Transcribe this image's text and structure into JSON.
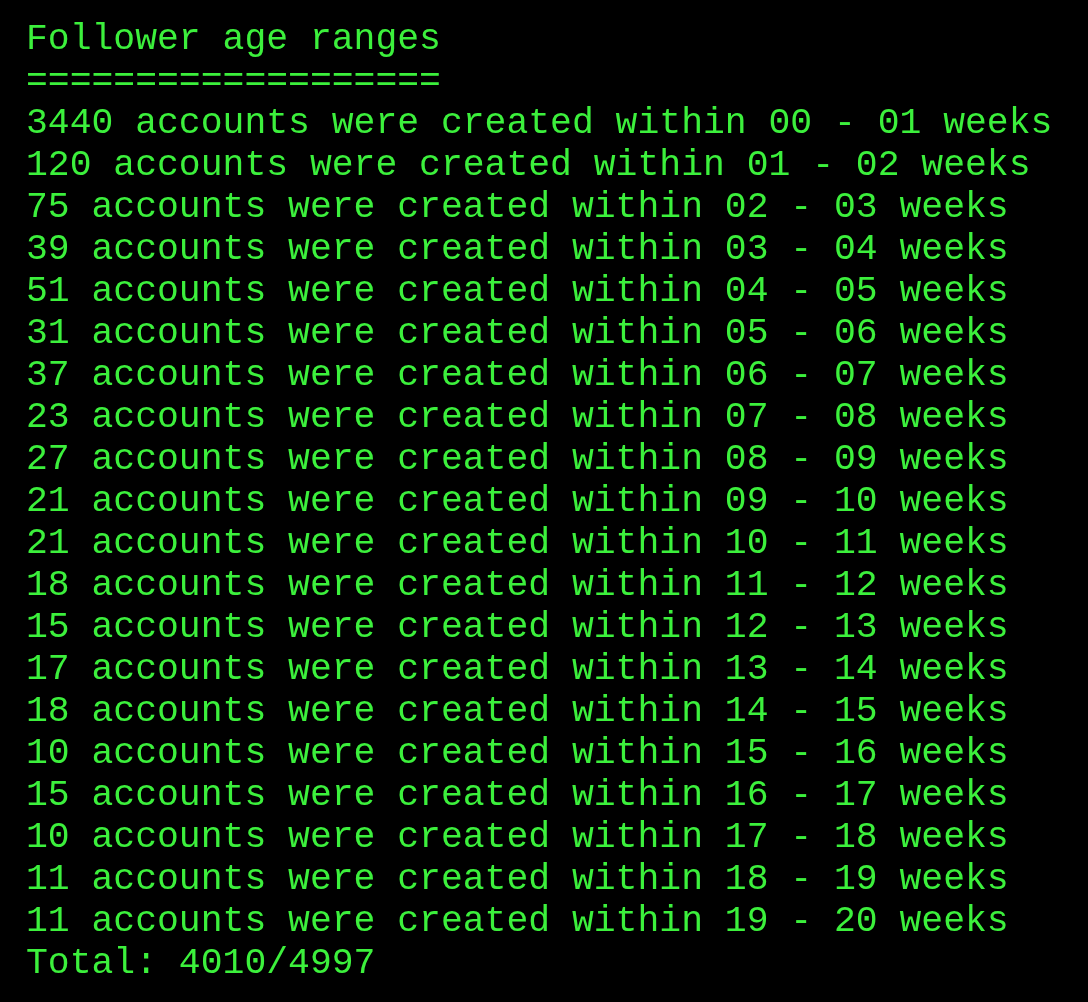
{
  "title": "Follower age ranges",
  "underline": "===================",
  "lines": [
    "3440 accounts were created within 00 - 01 weeks",
    "120 accounts were created within 01 - 02 weeks",
    "75 accounts were created within 02 - 03 weeks",
    "39 accounts were created within 03 - 04 weeks",
    "51 accounts were created within 04 - 05 weeks",
    "31 accounts were created within 05 - 06 weeks",
    "37 accounts were created within 06 - 07 weeks",
    "23 accounts were created within 07 - 08 weeks",
    "27 accounts were created within 08 - 09 weeks",
    "21 accounts were created within 09 - 10 weeks",
    "21 accounts were created within 10 - 11 weeks",
    "18 accounts were created within 11 - 12 weeks",
    "15 accounts were created within 12 - 13 weeks",
    "17 accounts were created within 13 - 14 weeks",
    "18 accounts were created within 14 - 15 weeks",
    "10 accounts were created within 15 - 16 weeks",
    "15 accounts were created within 16 - 17 weeks",
    "10 accounts were created within 17 - 18 weeks",
    "11 accounts were created within 18 - 19 weeks",
    "11 accounts were created within 19 - 20 weeks"
  ],
  "total": "Total: 4010/4997"
}
